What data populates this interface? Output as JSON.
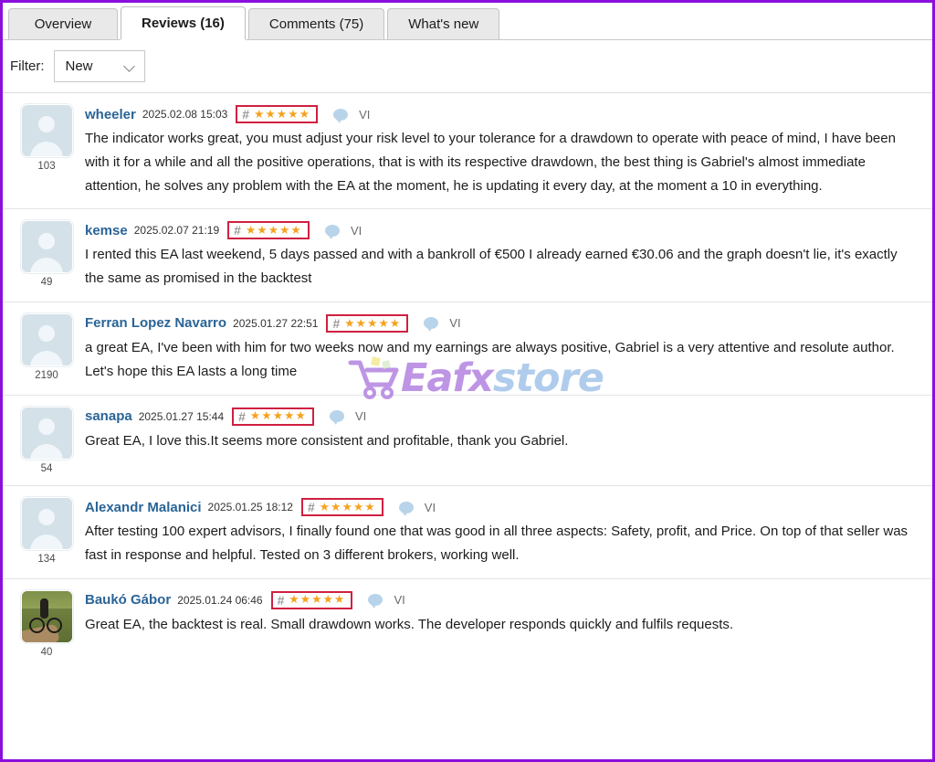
{
  "tabs": [
    {
      "label": "Overview",
      "active": false
    },
    {
      "label": "Reviews (16)",
      "active": true
    },
    {
      "label": "Comments (75)",
      "active": false
    },
    {
      "label": "What's new",
      "active": false
    }
  ],
  "filter": {
    "label": "Filter:",
    "value": "New",
    "chevron_icon": "chevron-down-icon"
  },
  "colors": {
    "page_border": "#8a0fdc",
    "rating_border": "#d02040",
    "star": "#f5a11d",
    "username": "#2a6496",
    "bubble": "#b8d4ea",
    "watermark_eafx": "#b07ee0",
    "watermark_store": "#9fc2e8"
  },
  "icons": {
    "hash": "#",
    "stars": "★★★★★",
    "bubble": "speech-bubble-icon",
    "vi_label": "VI"
  },
  "reviews": [
    {
      "username": "wheeler",
      "timestamp": "2025.02.08 15:03",
      "rating": 5,
      "stars": "★★★★★",
      "vi": "VI",
      "avatar_type": "placeholder",
      "avatar_count": "103",
      "text": "The indicator works great, you must adjust your risk level to your tolerance for a drawdown to operate with peace of mind, I have been with it for a while and all the positive operations, that is with its respective drawdown, the best thing is Gabriel's almost immediate attention, he solves any problem with the EA at the moment, he is updating it every day, at the moment a 10 in everything."
    },
    {
      "username": "kemse",
      "timestamp": "2025.02.07 21:19",
      "rating": 5,
      "stars": "★★★★★",
      "vi": "VI",
      "avatar_type": "placeholder",
      "avatar_count": "49",
      "text": "I rented this EA last weekend, 5 days passed and with a bankroll of €500 I already earned €30.06 and the graph doesn't lie, it's exactly the same as promised in the backtest"
    },
    {
      "username": "Ferran Lopez Navarro",
      "timestamp": "2025.01.27 22:51",
      "rating": 5,
      "stars": "★★★★★",
      "vi": "VI",
      "avatar_type": "placeholder",
      "avatar_count": "2190",
      "text": "a great EA, I've been with him for two weeks now and my earnings are always positive, Gabriel is a very attentive and resolute author. Let's hope this EA lasts a long time"
    },
    {
      "username": "sanapa",
      "timestamp": "2025.01.27 15:44",
      "rating": 5,
      "stars": "★★★★★",
      "vi": "VI",
      "avatar_type": "placeholder",
      "avatar_count": "54",
      "text": "Great EA, I love this.It seems more consistent and profitable, thank you Gabriel."
    },
    {
      "username": "Alexandr Malanici",
      "timestamp": "2025.01.25 18:12",
      "rating": 5,
      "stars": "★★★★★",
      "vi": "VI",
      "avatar_type": "placeholder",
      "avatar_count": "134",
      "text": "After testing 100 expert advisors, I finally found one that was good in all three aspects: Safety, profit, and Price. On top of that seller was fast in response and helpful. Tested on 3 different brokers, working well."
    },
    {
      "username": "Baukó Gábor",
      "timestamp": "2025.01.24 06:46",
      "rating": 5,
      "stars": "★★★★★",
      "vi": "VI",
      "avatar_type": "photo",
      "avatar_count": "40",
      "text": "Great EA, the backtest is real. Small drawdown works. The developer responds quickly and fulfils requests."
    }
  ],
  "watermark": {
    "primary": "Eafx",
    "secondary": "store",
    "cart_icon": "shopping-cart-icon"
  }
}
